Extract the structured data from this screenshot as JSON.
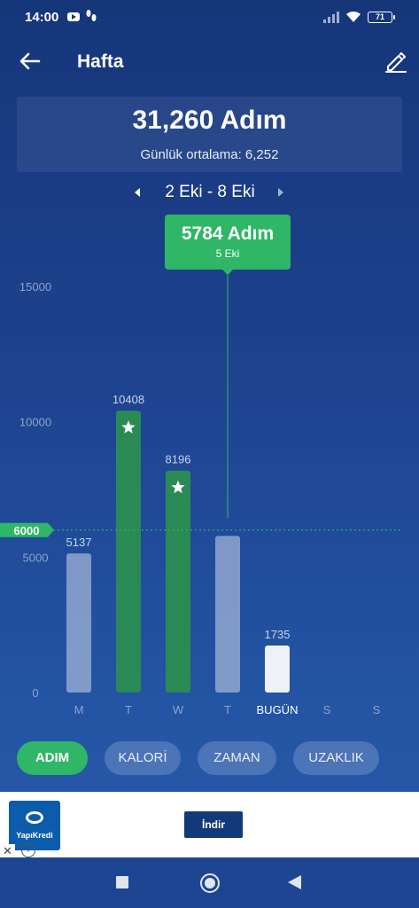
{
  "status_bar": {
    "time": "14:00",
    "battery": "71"
  },
  "header": {
    "title": "Hafta"
  },
  "summary": {
    "total": "31,260 Adım",
    "average_label": "Günlük ortalama:",
    "average_value": "6,252"
  },
  "week_nav": {
    "label": "2 Eki - 8 Eki"
  },
  "tooltip": {
    "steps": "5784 Adım",
    "date": "5 Eki"
  },
  "colors": {
    "goal_bar": "#2a8a56",
    "normal_bar": "rgba(205,215,235,0.55)",
    "today_bar": "#eef2f8",
    "accent": "#2fb666",
    "goal_line": "#2fb666"
  },
  "chart_data": {
    "type": "bar",
    "categories": [
      "M",
      "T",
      "W",
      "T",
      "BUGÜN",
      "S",
      "S"
    ],
    "values": [
      5137,
      10408,
      8196,
      5784,
      1735,
      null,
      null
    ],
    "value_labels": [
      "5137",
      "10408",
      "8196",
      "",
      "1735",
      "",
      ""
    ],
    "goal_met": [
      false,
      true,
      true,
      false,
      false,
      false,
      false
    ],
    "today_index": 4,
    "selected_index": 3,
    "goal": 6000,
    "goal_label": "6000",
    "yticks": [
      0,
      5000,
      10000,
      15000
    ],
    "ytick_labels": [
      "0",
      "5000",
      "10000",
      "15000"
    ],
    "ylim": [
      0,
      15000
    ],
    "title": "",
    "xlabel": "",
    "ylabel": ""
  },
  "tabs": [
    {
      "label": "ADIM",
      "active": true
    },
    {
      "label": "KALORİ",
      "active": false
    },
    {
      "label": "ZAMAN",
      "active": false
    },
    {
      "label": "UZAKLIK",
      "active": false
    }
  ],
  "ad": {
    "brand": "YapıKredi",
    "install_label": "İndir",
    "close_label": "✕",
    "info_label": "i"
  }
}
